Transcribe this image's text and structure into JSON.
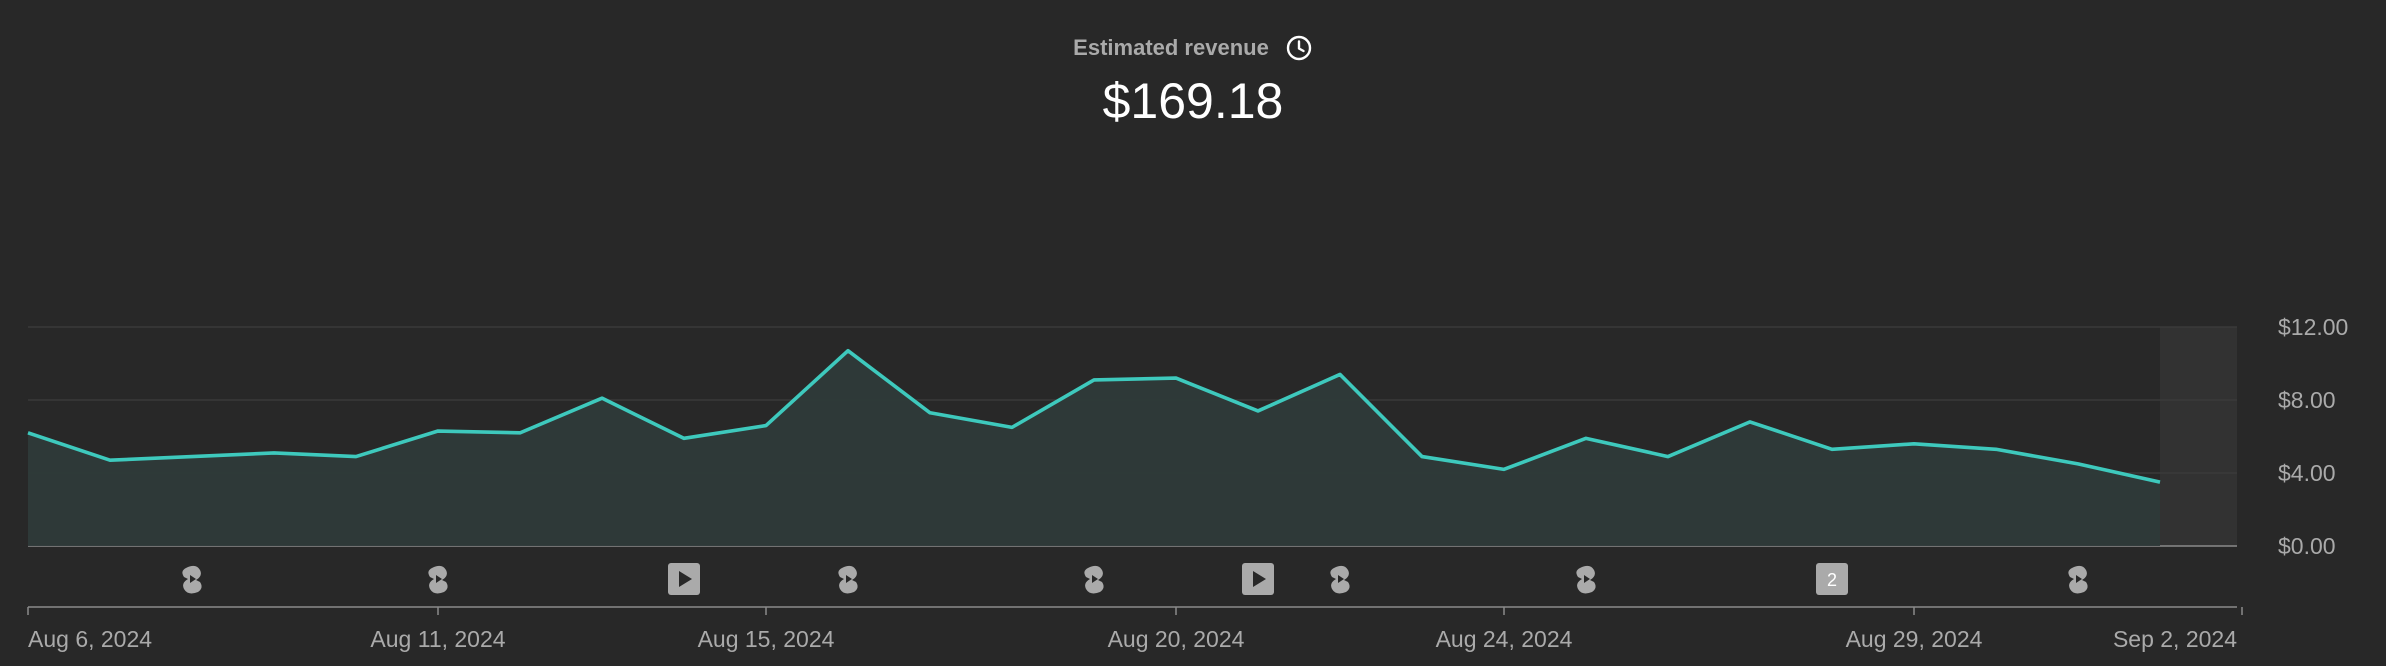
{
  "metric": {
    "label": "Estimated revenue",
    "value": "$169.18"
  },
  "colors": {
    "background": "#282828",
    "line": "#3ec9bd",
    "area": "#2e3a39",
    "grid": "#3d3d3d",
    "icon": "#aaaaaa",
    "text_secondary": "#aaaaaa"
  },
  "chart_data": {
    "type": "area",
    "title": "",
    "xlabel": "",
    "ylabel": "",
    "x": [
      "Aug 6, 2024",
      "Aug 7, 2024",
      "Aug 8, 2024",
      "Aug 9, 2024",
      "Aug 10, 2024",
      "Aug 11, 2024",
      "Aug 12, 2024",
      "Aug 13, 2024",
      "Aug 14, 2024",
      "Aug 15, 2024",
      "Aug 16, 2024",
      "Aug 17, 2024",
      "Aug 18, 2024",
      "Aug 19, 2024",
      "Aug 20, 2024",
      "Aug 21, 2024",
      "Aug 22, 2024",
      "Aug 23, 2024",
      "Aug 24, 2024",
      "Aug 25, 2024",
      "Aug 26, 2024",
      "Aug 27, 2024",
      "Aug 28, 2024",
      "Aug 29, 2024",
      "Aug 30, 2024",
      "Aug 31, 2024",
      "Sep 1, 2024"
    ],
    "y": [
      6.2,
      4.7,
      4.9,
      5.1,
      4.9,
      6.3,
      6.2,
      8.1,
      5.9,
      6.6,
      10.7,
      7.3,
      6.5,
      9.1,
      9.2,
      7.4,
      9.4,
      4.9,
      4.2,
      5.9,
      4.9,
      6.8,
      5.3,
      5.6,
      5.3,
      4.5,
      3.5
    ],
    "x_ticks": [
      "Aug 6, 2024",
      "Aug 11, 2024",
      "Aug 15, 2024",
      "Aug 20, 2024",
      "Aug 24, 2024",
      "Aug 29, 2024",
      "Sep 2, 2024"
    ],
    "x_tick_index": [
      0,
      5,
      9,
      14,
      18,
      23,
      27
    ],
    "y_ticks": [
      "$0.00",
      "$4.00",
      "$8.00",
      "$12.00"
    ],
    "y_tick_values": [
      0,
      4,
      8,
      12
    ],
    "ylim": [
      0,
      12
    ],
    "grid": true,
    "axis_position": "right",
    "partial_period_from_index": 26,
    "markers": [
      {
        "index": 2,
        "icon": "shorts-icon"
      },
      {
        "index": 5,
        "icon": "shorts-icon"
      },
      {
        "index": 8,
        "icon": "video-play-icon"
      },
      {
        "index": 10,
        "icon": "shorts-icon"
      },
      {
        "index": 13,
        "icon": "shorts-icon"
      },
      {
        "index": 15,
        "icon": "video-play-icon"
      },
      {
        "index": 16,
        "icon": "shorts-icon"
      },
      {
        "index": 19,
        "icon": "shorts-icon"
      },
      {
        "index": 22,
        "icon": "count-badge-icon",
        "label": "2"
      },
      {
        "index": 25,
        "icon": "shorts-icon"
      }
    ]
  }
}
